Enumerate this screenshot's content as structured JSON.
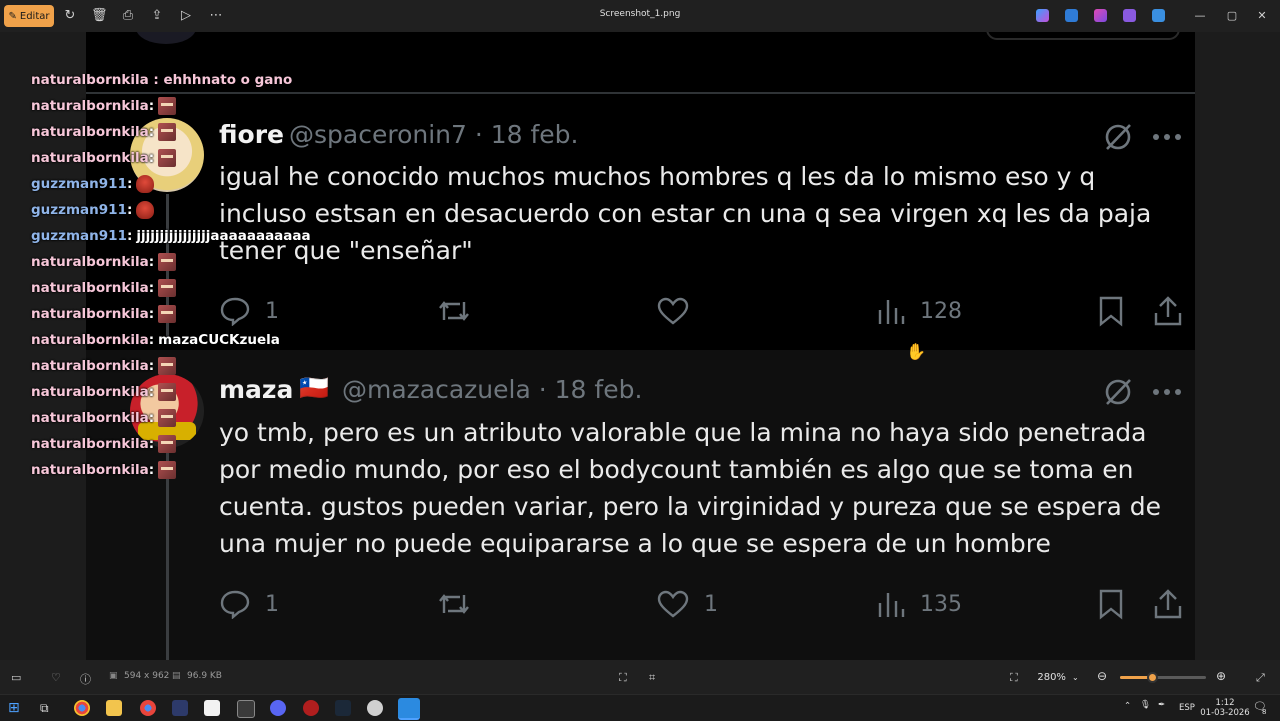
{
  "window": {
    "title": "Screenshot_1.png",
    "edit_label": "Editar"
  },
  "tweets": [
    {
      "name": "fiore",
      "flag": "",
      "handle": "@spaceronin7 · 18 feb.",
      "text": "igual he conocido muchos muchos hombres q les da lo mismo eso y q incluso estsan en desacuerdo con estar cn una q sea virgen xq les da paja tener que \"enseñar\"",
      "replies": "1",
      "retweets": "",
      "likes": "",
      "views": "128"
    },
    {
      "name": "maza",
      "flag": "🇨🇱",
      "handle": "@mazacazuela · 18 feb.",
      "text": "yo tmb, pero es un atributo valorable que la mina no haya sido penetrada por medio mundo, por eso el bodycount también es algo que se toma en cuenta. gustos pueden variar, pero la virginidad y pureza que se espera de una mujer no puede equipararse a lo que se espera de un hombre",
      "replies": "1",
      "retweets": "",
      "likes": "1",
      "views": "135"
    }
  ],
  "chat": {
    "partial_top": "naturalbornkila : ehhhnato o gano",
    "lines": [
      {
        "user": "naturalbornkila",
        "sep": " :",
        "message": "",
        "emote": "mask",
        "color": "pink"
      },
      {
        "user": "naturalbornkila",
        "sep": " :",
        "message": "",
        "emote": "mask",
        "color": "pink"
      },
      {
        "user": "naturalbornkila",
        "sep": " :",
        "message": "",
        "emote": "mask",
        "color": "pink"
      },
      {
        "user": "guzzman911",
        "sep": " :",
        "message": "",
        "emote": "red",
        "color": "blue"
      },
      {
        "user": "guzzman911",
        "sep": " :",
        "message": "",
        "emote": "red",
        "color": "blue"
      },
      {
        "user": "guzzman911",
        "sep": " :",
        "message": "jjjjjjjjjjjjjjjjaaaaaaaaaaa",
        "emote": "",
        "color": "blue"
      },
      {
        "user": "naturalbornkila",
        "sep": " :",
        "message": "",
        "emote": "mask",
        "color": "pink"
      },
      {
        "user": "naturalbornkila",
        "sep": " :",
        "message": "",
        "emote": "mask",
        "color": "pink"
      },
      {
        "user": "naturalbornkila",
        "sep": " :",
        "message": "",
        "emote": "mask",
        "color": "pink"
      },
      {
        "user": "naturalbornkila",
        "sep": " :",
        "message": "mazaCUCKzuela",
        "emote": "",
        "color": "pink"
      },
      {
        "user": "naturalbornkila",
        "sep": " :",
        "message": "",
        "emote": "mask",
        "color": "pink"
      },
      {
        "user": "naturalbornkila",
        "sep": " :",
        "message": "",
        "emote": "mask",
        "color": "pink"
      },
      {
        "user": "naturalbornkila",
        "sep": " :",
        "message": "",
        "emote": "mask",
        "color": "pink"
      },
      {
        "user": "naturalbornkila",
        "sep": " :",
        "message": "",
        "emote": "mask",
        "color": "pink"
      },
      {
        "user": "naturalbornkila",
        "sep": " :",
        "message": "",
        "emote": "mask",
        "color": "pink"
      }
    ]
  },
  "status": {
    "dimensions": "594 x 962",
    "filesize": "96.9 KB",
    "zoom": "280%",
    "zoom_fraction": 0.37
  },
  "taskbar": {
    "lang": "ESP",
    "time": "1:12",
    "date": "01-03-2026",
    "notif": "8"
  },
  "colors": {
    "accent": "#f0a24a",
    "tweet_bg": "#000000",
    "muted": "#6e767d"
  }
}
